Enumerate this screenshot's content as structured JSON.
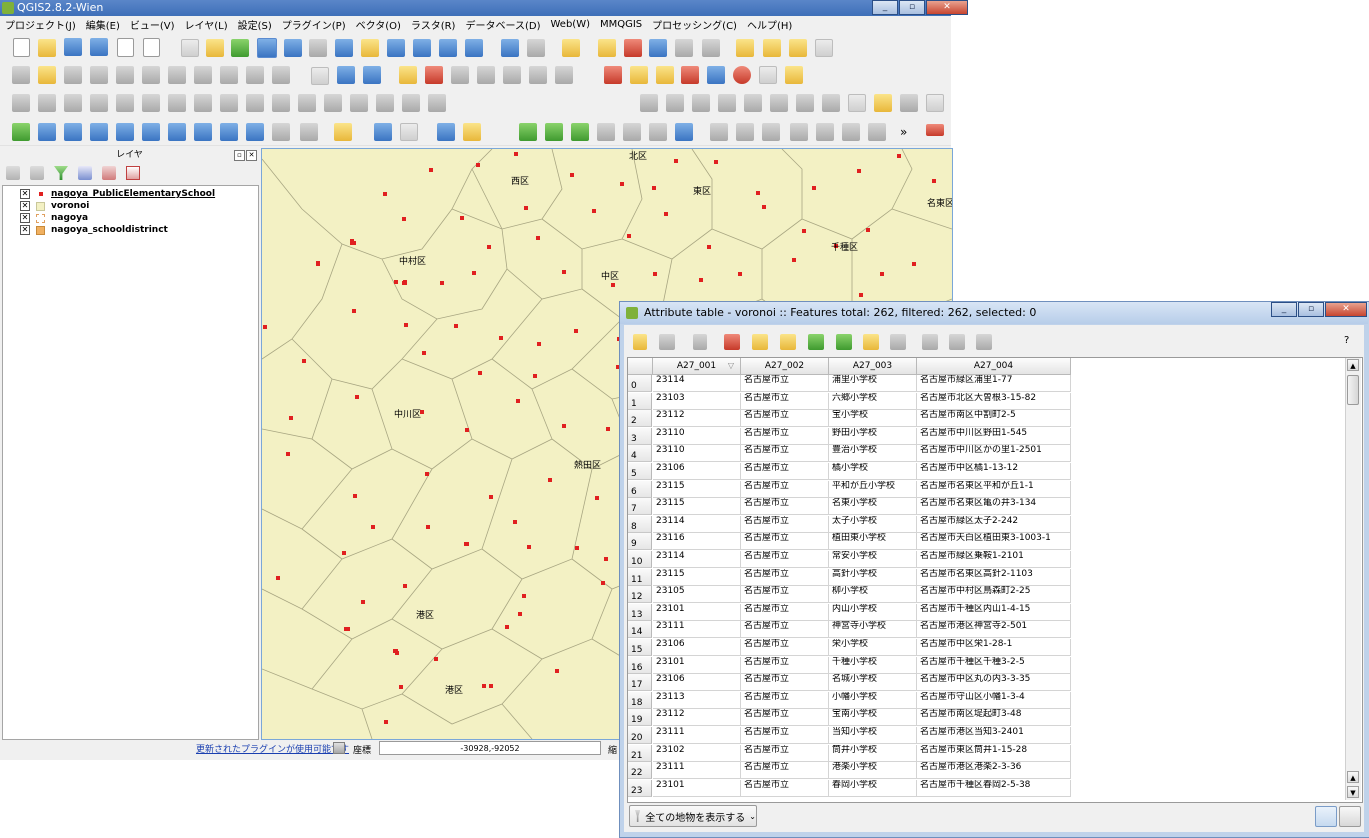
{
  "qgis": {
    "title": "QGIS2.8.2-Wien",
    "menu": [
      "プロジェクト(J)",
      "編集(E)",
      "ビュー(V)",
      "レイヤ(L)",
      "設定(S)",
      "プラグイン(P)",
      "ベクタ(O)",
      "ラスタ(R)",
      "データベース(D)",
      "Web(W)",
      "MMQGIS",
      "プロセッシング(C)",
      "ヘルプ(H)"
    ],
    "layers_title": "レイヤ",
    "layers": [
      {
        "name": "nagoya_PublicElementarySchool",
        "symbol": "point",
        "color": "#e02020"
      },
      {
        "name": "voronoi",
        "symbol": "fill",
        "color": "#f3f1c4"
      },
      {
        "name": "nagoya",
        "symbol": "outline",
        "color": "#e8c090"
      },
      {
        "name": "nagoya_schooldistrinct",
        "symbol": "fill",
        "color": "#f0b060"
      }
    ],
    "map_labels": [
      "北区",
      "西区",
      "東区",
      "名東区",
      "中村区",
      "中区",
      "千種区",
      "中川区",
      "熱田区",
      "港区",
      "港区"
    ],
    "status": {
      "plugin_notice": "更新されたプラグインが使用可能です",
      "coord_label": "座標",
      "coord_value": "-30928,-92052",
      "scale_label_partial": "縮"
    }
  },
  "attr_table": {
    "title": "Attribute table - voronoi :: Features total: 262, filtered: 262, selected: 0",
    "help": "?",
    "columns": [
      "A27_001",
      "A27_002",
      "A27_003",
      "A27_004"
    ],
    "rows": [
      [
        "0",
        "23114",
        "名古屋市立",
        "浦里小学校",
        "名古屋市緑区浦里1-77"
      ],
      [
        "1",
        "23103",
        "名古屋市立",
        "六郷小学校",
        "名古屋市北区大曽根3-15-82"
      ],
      [
        "2",
        "23112",
        "名古屋市立",
        "宝小学校",
        "名古屋市南区中割町2-5"
      ],
      [
        "3",
        "23110",
        "名古屋市立",
        "野田小学校",
        "名古屋市中川区野田1-545"
      ],
      [
        "4",
        "23110",
        "名古屋市立",
        "豊治小学校",
        "名古屋市中川区かの里1-2501"
      ],
      [
        "5",
        "23106",
        "名古屋市立",
        "橘小学校",
        "名古屋市中区橘1-13-12"
      ],
      [
        "6",
        "23115",
        "名古屋市立",
        "平和が丘小学校",
        "名古屋市名東区平和が丘1-1"
      ],
      [
        "7",
        "23115",
        "名古屋市立",
        "名東小学校",
        "名古屋市名東区亀の井3-134"
      ],
      [
        "8",
        "23114",
        "名古屋市立",
        "太子小学校",
        "名古屋市緑区太子2-242"
      ],
      [
        "9",
        "23116",
        "名古屋市立",
        "植田東小学校",
        "名古屋市天白区植田東3-1003-1"
      ],
      [
        "10",
        "23114",
        "名古屋市立",
        "常安小学校",
        "名古屋市緑区乗鞍1-2101"
      ],
      [
        "11",
        "23115",
        "名古屋市立",
        "高針小学校",
        "名古屋市名東区高針2-1103"
      ],
      [
        "12",
        "23105",
        "名古屋市立",
        "柳小学校",
        "名古屋市中村区鳥森町2-25"
      ],
      [
        "13",
        "23101",
        "名古屋市立",
        "内山小学校",
        "名古屋市千種区内山1-4-15"
      ],
      [
        "14",
        "23111",
        "名古屋市立",
        "神宮寺小学校",
        "名古屋市港区神宮寺2-501"
      ],
      [
        "15",
        "23106",
        "名古屋市立",
        "栄小学校",
        "名古屋市中区栄1-28-1"
      ],
      [
        "16",
        "23101",
        "名古屋市立",
        "千種小学校",
        "名古屋市千種区千種3-2-5"
      ],
      [
        "17",
        "23106",
        "名古屋市立",
        "名城小学校",
        "名古屋市中区丸の内3-3-35"
      ],
      [
        "18",
        "23113",
        "名古屋市立",
        "小幡小学校",
        "名古屋市守山区小幡1-3-4"
      ],
      [
        "19",
        "23112",
        "名古屋市立",
        "宝南小学校",
        "名古屋市南区堤起町3-48"
      ],
      [
        "20",
        "23111",
        "名古屋市立",
        "当知小学校",
        "名古屋市港区当知3-2401"
      ],
      [
        "21",
        "23102",
        "名古屋市立",
        "筒井小学校",
        "名古屋市東区筒井1-15-28"
      ],
      [
        "22",
        "23111",
        "名古屋市立",
        "港楽小学校",
        "名古屋市港区港楽2-3-36"
      ],
      [
        "23",
        "23101",
        "名古屋市立",
        "春岡小学校",
        "名古屋市千種区春岡2-5-38"
      ]
    ],
    "filter_button": "全ての地物を表示する"
  }
}
